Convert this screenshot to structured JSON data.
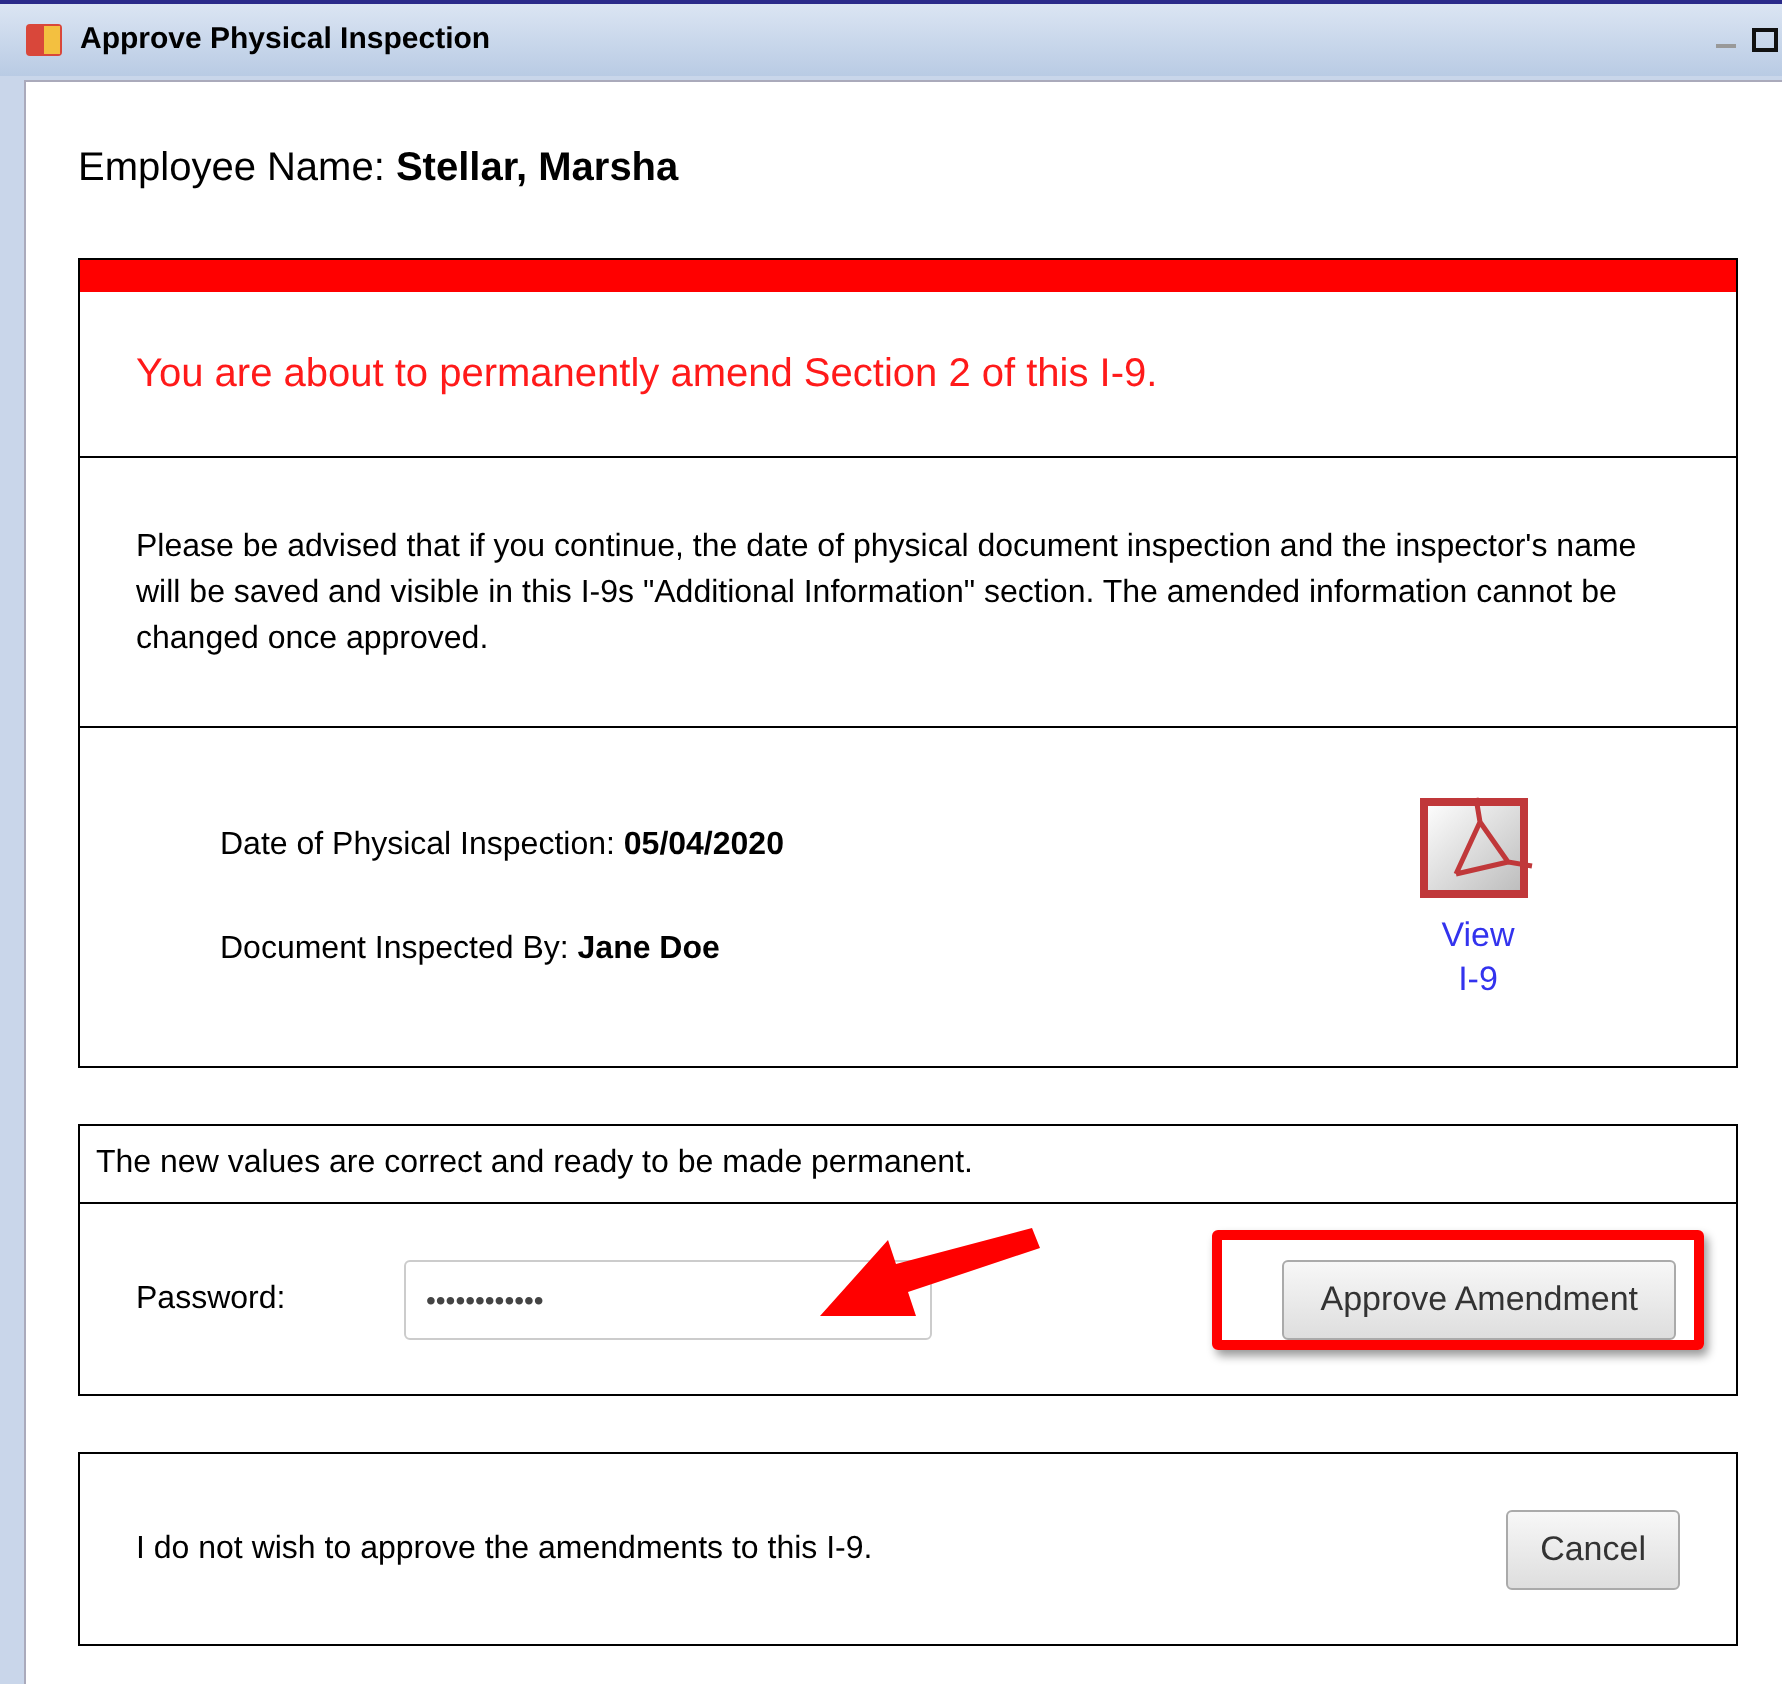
{
  "window": {
    "title": "Approve Physical Inspection"
  },
  "employee": {
    "label": "Employee Name:",
    "value": "Stellar, Marsha"
  },
  "warning": "You are about to permanently amend Section 2 of this I-9.",
  "notice": "Please be advised that if you continue, the date of physical document inspection and the inspector's name will be saved and visible in this I-9s \"Additional Information\" section. The amended information cannot be changed once approved.",
  "details": [
    {
      "label": "Date of Physical Inspection:",
      "value": "05/04/2020"
    },
    {
      "label": "Document Inspected By:",
      "value": "Jane Doe"
    }
  ],
  "view_link": [
    "View",
    "I-9"
  ],
  "confirm": {
    "heading": "The new values are correct and ready to be made permanent.",
    "password_label": "Password:",
    "password_value": "••••••••••••",
    "approve_button": "Approve Amendment"
  },
  "decline": {
    "text": "I do not wish to approve the amendments to this I-9.",
    "cancel_button": "Cancel"
  }
}
